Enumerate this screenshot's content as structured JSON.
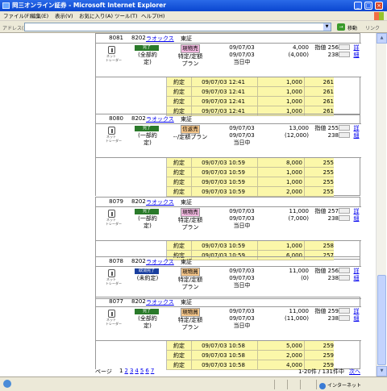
{
  "window": {
    "title": "岡三オンライン証券 - Microsoft Internet Explorer",
    "minimize": "_",
    "maximize": "□",
    "close": "×"
  },
  "menu": [
    "ファイル(F)",
    "編集(E)",
    "表示(V)",
    "お気に入り(A)",
    "ツール(T)",
    "ヘルプ(H)"
  ],
  "address": {
    "label": "アドレス(D)",
    "value": "",
    "go_label": "移動",
    "links_label": "リンク"
  },
  "orders": [
    {
      "no": "8081",
      "code": "8202",
      "name": "ラオックス",
      "market": "東証",
      "badge": "完了",
      "badge_color": "#2a7a2a",
      "status_sub": [
        "(全部約",
        "定)"
      ],
      "icon_label": "ネット\nトレーダー",
      "condition_tag": "現物売",
      "condition_tag_color": "#f2b8e0",
      "condition_lines": [
        "特定/定額",
        "プラン"
      ],
      "date_lines": [
        "09/07/03",
        "09/07/03",
        "当日中"
      ],
      "qty_lines": [
        "4,000",
        "(4,000)"
      ],
      "price_lines": [
        "指値 256",
        "238"
      ],
      "detail_label": "詳細",
      "fills": [
        {
          "label": "約定",
          "datetime": "09/07/03 12:41",
          "qty": "1,000",
          "price": "261"
        },
        {
          "label": "約定",
          "datetime": "09/07/03 12:41",
          "qty": "1,000",
          "price": "261"
        },
        {
          "label": "約定",
          "datetime": "09/07/03 12:41",
          "qty": "1,000",
          "price": "261"
        },
        {
          "label": "約定",
          "datetime": "09/07/03 12:41",
          "qty": "1,000",
          "price": "261"
        }
      ]
    },
    {
      "no": "8080",
      "code": "8202",
      "name": "ラオックス",
      "market": "東証",
      "badge": "完了",
      "badge_color": "#2a7a2a",
      "status_sub": [
        "(一部約",
        "定)"
      ],
      "icon_label": "ネット\nトレーダー",
      "condition_tag": "信返売",
      "condition_tag_color": "#f5c68a",
      "condition_lines": [
        "--/定額プラン"
      ],
      "date_lines": [
        "09/07/03",
        "09/07/03",
        "当日中"
      ],
      "qty_lines": [
        "13,000",
        "(12,000)"
      ],
      "price_lines": [
        "指値 255",
        "238"
      ],
      "detail_label": "詳細",
      "fills": [
        {
          "label": "約定",
          "datetime": "09/07/03 10:59",
          "qty": "8,000",
          "price": "255"
        },
        {
          "label": "約定",
          "datetime": "09/07/03 10:59",
          "qty": "1,000",
          "price": "255"
        },
        {
          "label": "約定",
          "datetime": "09/07/03 10:59",
          "qty": "1,000",
          "price": "255"
        },
        {
          "label": "約定",
          "datetime": "09/07/03 10:59",
          "qty": "2,000",
          "price": "255"
        }
      ]
    },
    {
      "no": "8079",
      "code": "8202",
      "name": "ラオックス",
      "market": "東証",
      "badge": "完了",
      "badge_color": "#2a7a2a",
      "status_sub": [
        "(一部約",
        "定)"
      ],
      "icon_label": "ネット\nトレーダー",
      "condition_tag": "現物売",
      "condition_tag_color": "#f2b8e0",
      "condition_lines": [
        "特定/定額",
        "プラン"
      ],
      "date_lines": [
        "09/07/03",
        "09/07/03",
        "当日中"
      ],
      "qty_lines": [
        "11,000",
        "(7,000)"
      ],
      "price_lines": [
        "指値 257",
        "238"
      ],
      "detail_label": "詳細",
      "fills": [
        {
          "label": "約定",
          "datetime": "09/07/03 10:59",
          "qty": "1,000",
          "price": "258"
        },
        {
          "label": "約定",
          "datetime": "09/07/03 10:59",
          "qty": "6,000",
          "price": "257"
        }
      ]
    },
    {
      "no": "8078",
      "code": "8202",
      "name": "ラオックス",
      "market": "東証",
      "badge": "取消完了",
      "badge_color": "#1a3f9f",
      "status_sub": [
        "(未約定)"
      ],
      "icon_label": "ネット\nトレーダー",
      "condition_tag": "現物買",
      "condition_tag_color": "#f5c68a",
      "condition_lines": [
        "特定/定額",
        "プラン"
      ],
      "date_lines": [
        "09/07/03",
        "09/07/03",
        "当日中"
      ],
      "qty_lines": [
        "11,000",
        "(0)"
      ],
      "price_lines": [
        "指値 256",
        "238"
      ],
      "detail_label": "詳細",
      "fills": []
    },
    {
      "no": "8077",
      "code": "8202",
      "name": "ラオックス",
      "market": "東証",
      "badge": "完了",
      "badge_color": "#2a7a2a",
      "status_sub": [
        "(全部約",
        "定)"
      ],
      "icon_label": "ネット\nトレーダー",
      "condition_tag": "現物買",
      "condition_tag_color": "#f5c68a",
      "condition_lines": [
        "特定/定額",
        "プラン"
      ],
      "date_lines": [
        "09/07/03",
        "09/07/03",
        "当日中"
      ],
      "qty_lines": [
        "11,000",
        "(11,000)"
      ],
      "price_lines": [
        "指値 259",
        "238"
      ],
      "detail_label": "詳細",
      "fills": [
        {
          "label": "約定",
          "datetime": "09/07/03 10:58",
          "qty": "5,000",
          "price": "259"
        },
        {
          "label": "約定",
          "datetime": "09/07/03 10:58",
          "qty": "2,000",
          "price": "259"
        },
        {
          "label": "約定",
          "datetime": "09/07/03 10:58",
          "qty": "4,000",
          "price": "259"
        }
      ]
    }
  ],
  "pager": {
    "label": "ページ",
    "current": "1",
    "pages": [
      "2",
      "3",
      "4",
      "5",
      "6",
      "7"
    ],
    "summary": "1-20件 / 131件中",
    "next_label": "次へ"
  },
  "status": {
    "zone": "インターネット"
  }
}
